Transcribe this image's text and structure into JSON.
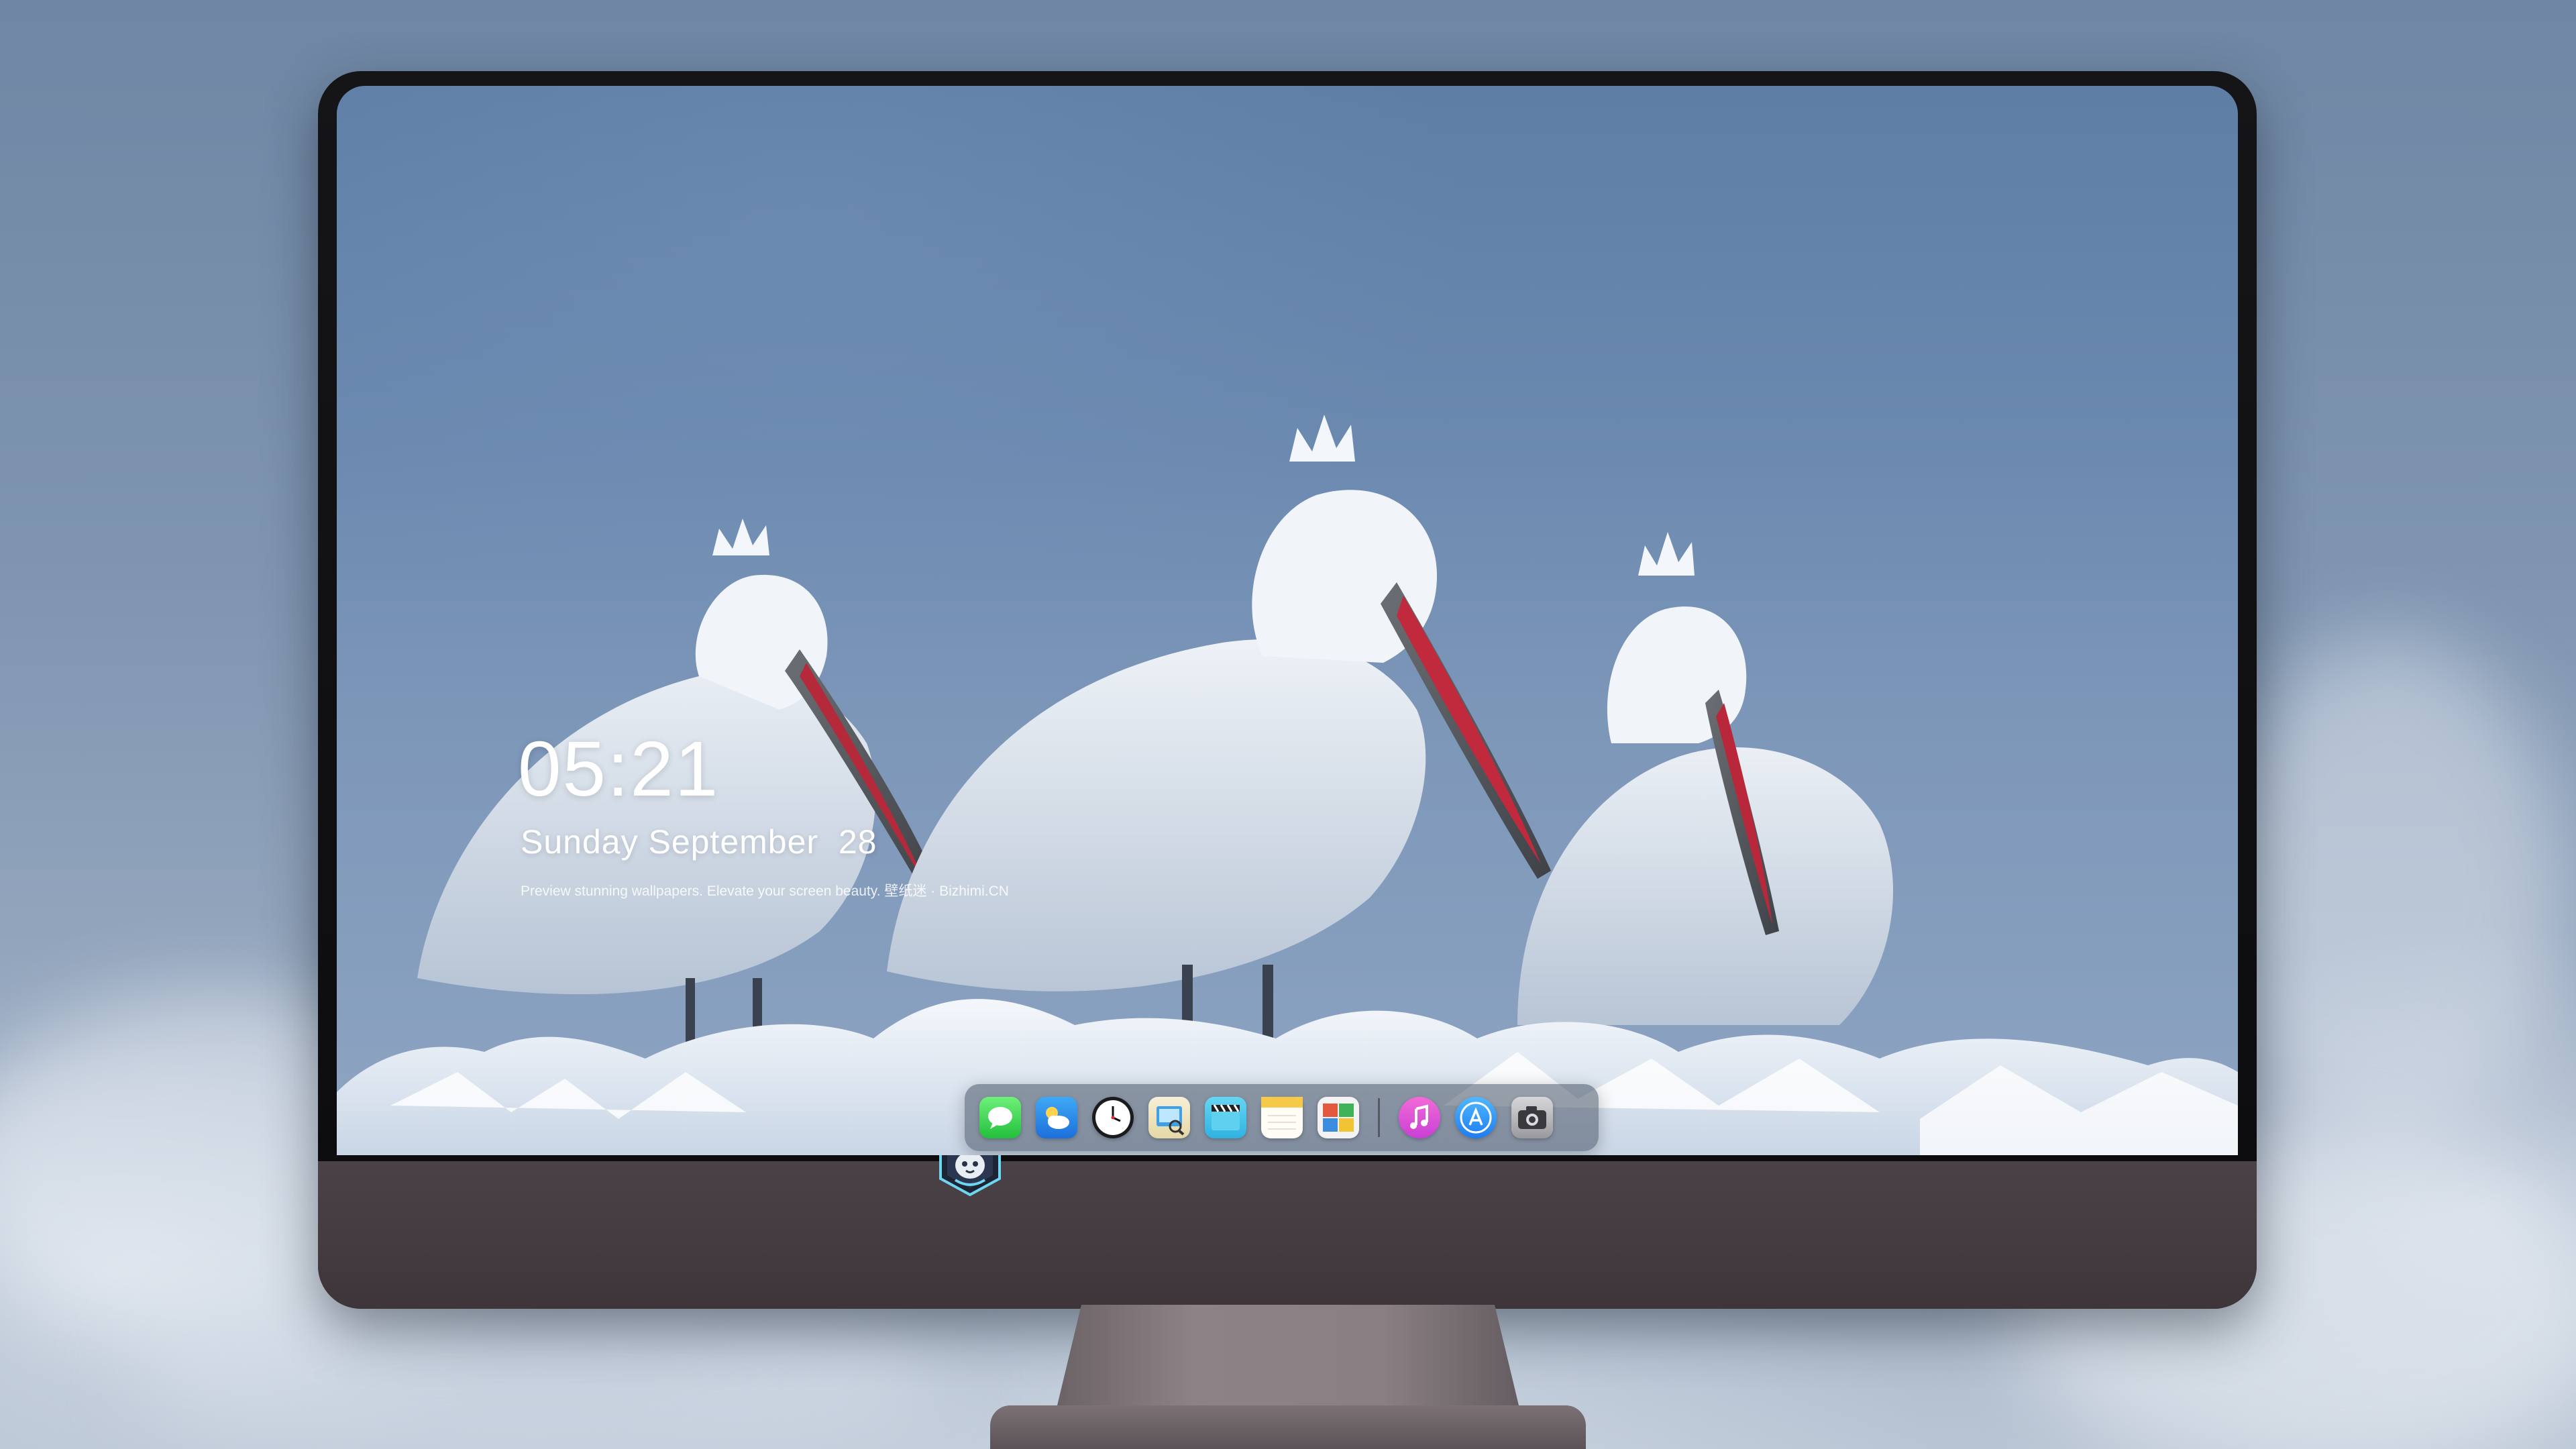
{
  "lock_screen": {
    "time": "05:21",
    "date": "Sunday September  28",
    "caption": "Preview stunning wallpapers. Elevate your screen beauty. 壁纸迷 · Bizhimi.CN"
  },
  "dock": {
    "apps": [
      {
        "name": "messages-icon"
      },
      {
        "name": "weather-icon"
      },
      {
        "name": "clock-icon"
      },
      {
        "name": "preview-icon"
      },
      {
        "name": "video-clapper-icon"
      },
      {
        "name": "notes-icon"
      },
      {
        "name": "photo-booth-icon"
      },
      {
        "name": "music-icon"
      },
      {
        "name": "app-store-icon"
      },
      {
        "name": "camera-icon"
      }
    ]
  },
  "colors": {
    "sky": "#6c8ab0",
    "monitor_bezel": "#0c0c0e",
    "monitor_chin": "#433b3f",
    "stand": "#8a8084"
  }
}
